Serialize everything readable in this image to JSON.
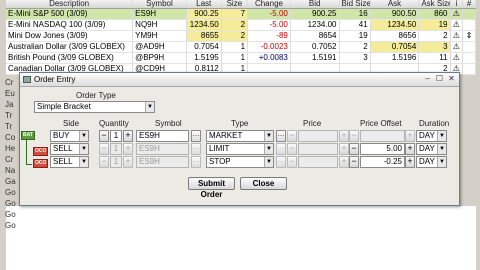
{
  "quotes": {
    "headers": [
      "Description",
      "Symbol",
      "Last",
      "Size",
      "Change",
      "Bid",
      "Bid Size",
      "Ask",
      "Ask Size",
      "i",
      "#"
    ],
    "rows": [
      {
        "desc": "E-Mini S&P 500 (3/09)",
        "sym": "ES9H",
        "last": "900.25",
        "size": "7",
        "chg": "-5.00",
        "bid": "900.25",
        "bsz": "16",
        "ask": "900.50",
        "asz": "860"
      },
      {
        "desc": "E-Mini NASDAQ 100 (3/09)",
        "sym": "NQ9H",
        "last": "1234.50",
        "size": "2",
        "chg": "-5.00",
        "bid": "1234.00",
        "bsz": "41",
        "ask": "1234.50",
        "asz": "19"
      },
      {
        "desc": "Mini Dow Jones (3/09)",
        "sym": "YM9H",
        "last": "8655",
        "size": "2",
        "chg": "-89",
        "bid": "8654",
        "bsz": "19",
        "ask": "8656",
        "asz": "2"
      },
      {
        "desc": "Australian Dollar (3/09 GLOBEX)",
        "sym": "@AD9H",
        "last": "0.7054",
        "size": "1",
        "chg": "-0.0023",
        "bid": "0.7052",
        "bsz": "2",
        "ask": "0.7054",
        "asz": "3"
      },
      {
        "desc": "British Pound (3/09 GLOBEX)",
        "sym": "@BP9H",
        "last": "1.5195",
        "size": "1",
        "chg": "+0.0083",
        "bid": "1.5191",
        "bsz": "3",
        "ask": "1.5196",
        "asz": "11"
      },
      {
        "desc": "Canadian Dollar (3/09 GLOBEX)",
        "sym": "@CD9H",
        "last": "0.8112",
        "size": "1",
        "chg": "",
        "bid": "",
        "bsz": "",
        "ask": "",
        "asz": "2"
      }
    ],
    "stubs": [
      "Cr",
      "Eu",
      "Ja",
      "Tr",
      "Tr",
      "Co",
      "He",
      "Cr",
      "Na",
      "Ga",
      "Go",
      "Go",
      "Go",
      "Go"
    ]
  },
  "dialog": {
    "title": "Order Entry",
    "order_type_label": "Order Type",
    "order_type": "Simple Bracket",
    "col_side": "Side",
    "col_qty": "Quantity",
    "col_symbol": "Symbol",
    "col_type": "Type",
    "col_price": "Price",
    "col_offset": "Price Offset",
    "col_duration": "Duration",
    "tag_bat": "BAT",
    "tag_oco": "OCO",
    "rows": [
      {
        "side": "BUY",
        "qty": "1",
        "symbol": "ES9H",
        "type": "MARKET",
        "price": "",
        "offset": "",
        "duration": "DAY"
      },
      {
        "side": "SELL",
        "qty": "1",
        "symbol": "ES9H",
        "type": "LIMIT",
        "price": "",
        "offset": "5.00",
        "duration": "DAY"
      },
      {
        "side": "SELL",
        "qty": "1",
        "symbol": "ES9H",
        "type": "STOP",
        "price": "",
        "offset": "-0.25",
        "duration": "DAY"
      }
    ],
    "submit": "Submit Order",
    "close": "Close"
  },
  "colors": {
    "selected_row": "#cfe6a8",
    "highlight": "#f5ec9a",
    "negative": "#cc0000",
    "bat": "#5c9c3a",
    "oco": "#d04c3c"
  }
}
